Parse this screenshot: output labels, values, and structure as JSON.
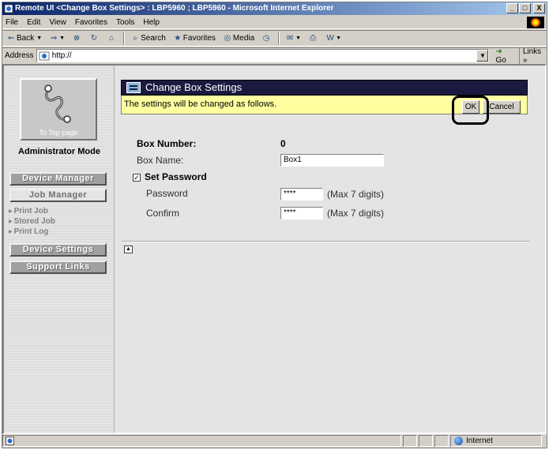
{
  "window": {
    "title": "Remote UI <Change Box Settings> : LBP5960 ; LBP5960 - Microsoft Internet Explorer",
    "minimize": "_",
    "maximize": "□",
    "close": "X"
  },
  "menu": [
    "File",
    "Edit",
    "View",
    "Favorites",
    "Tools",
    "Help"
  ],
  "toolbar": {
    "back": "Back",
    "search": "Search",
    "favorites": "Favorites",
    "media": "Media"
  },
  "address": {
    "label": "Address",
    "url": "http://",
    "go": "Go",
    "links": "Links »"
  },
  "sidebar": {
    "to_top": "To Top page",
    "admin_mode": "Administrator Mode",
    "device_manager": "Device Manager",
    "job_manager": "Job Manager",
    "print_job": "Print Job",
    "stored_job": "Stored Job",
    "print_log": "Print Log",
    "device_settings": "Device Settings",
    "support_links": "Support Links"
  },
  "main": {
    "header_title": "Change Box Settings",
    "notice": "The settings will be changed as follows.",
    "ok": "OK",
    "cancel": "Cancel",
    "box_number_label": "Box Number:",
    "box_number_value": "0",
    "box_name_label": "Box Name:",
    "box_name_value": "Box1",
    "set_password_label": "Set Password",
    "password_label": "Password",
    "password_value": "****",
    "password_hint": "(Max 7 digits)",
    "confirm_label": "Confirm",
    "confirm_value": "****",
    "confirm_hint": "(Max 7 digits)"
  },
  "status": {
    "zone": "Internet"
  }
}
